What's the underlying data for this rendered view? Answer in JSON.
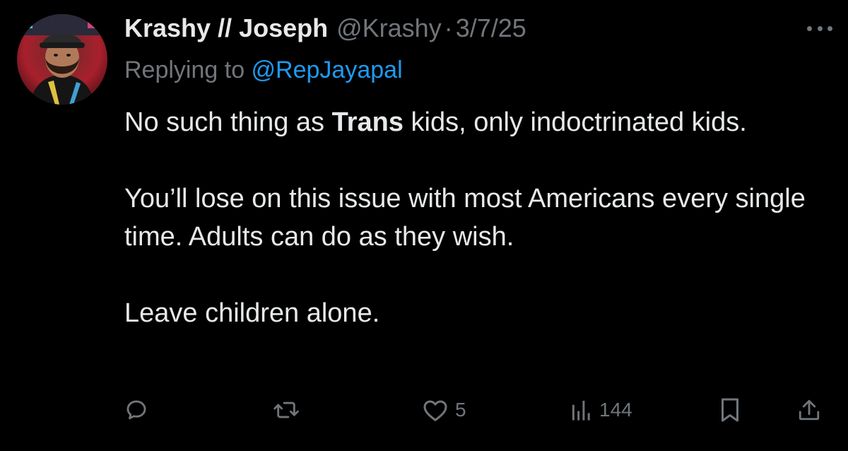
{
  "author": {
    "display_name": "Krashy // Joseph",
    "handle": "@Krashy",
    "date": "3/7/25",
    "separator": "·"
  },
  "reply": {
    "prefix": "Replying to ",
    "mention": "@RepJayapal"
  },
  "body": {
    "p1_before": "No such thing as ",
    "p1_bold": "Trans",
    "p1_after": " kids, only indoctrinated kids.",
    "p2": "You’ll lose on this issue with most Americans every single time. Adults can do as they wish.",
    "p3": "Leave children alone."
  },
  "actions": {
    "reply_icon": "speech-bubble-icon",
    "repost_icon": "repost-arrows-icon",
    "like_icon": "heart-icon",
    "like_count": "5",
    "views_icon": "bar-chart-icon",
    "views_count": "144",
    "bookmark_icon": "bookmark-icon",
    "share_icon": "share-upload-icon"
  },
  "colors": {
    "background": "#000000",
    "primary_text": "#e7e9ea",
    "secondary_text": "#71767b",
    "link": "#1d9bf0"
  }
}
